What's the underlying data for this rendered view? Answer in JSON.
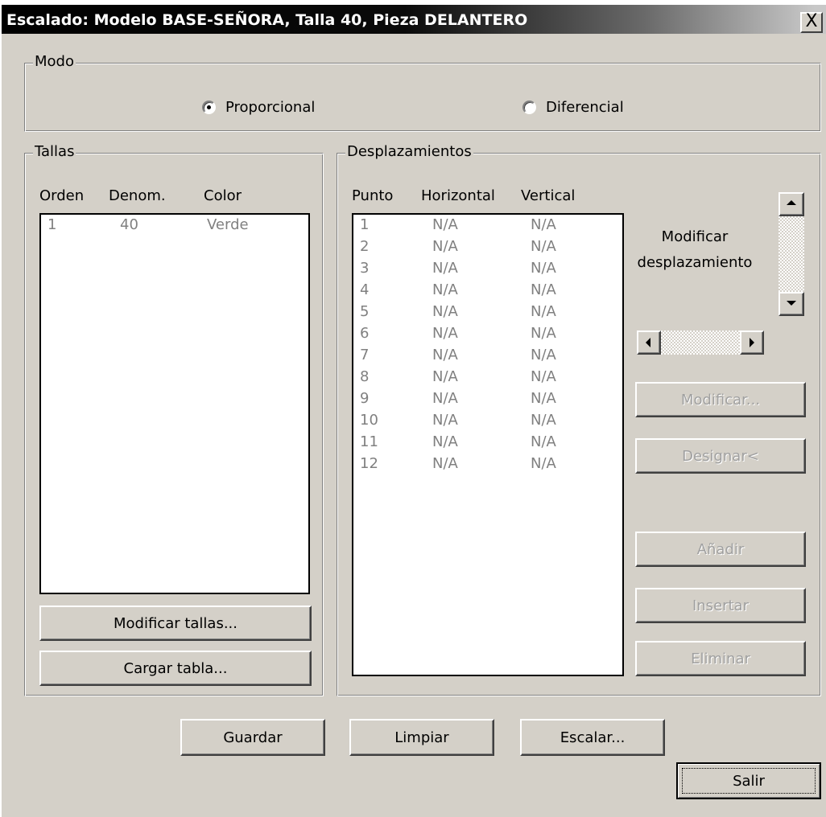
{
  "window": {
    "title": "Escalado: Modelo BASE-SEÑORA, Talla 40, Pieza DELANTERO",
    "close_label": "X"
  },
  "modo": {
    "legend": "Modo",
    "options": [
      {
        "label": "Proporcional",
        "selected": true
      },
      {
        "label": "Diferencial",
        "selected": false
      }
    ]
  },
  "tallas": {
    "legend": "Tallas",
    "headers": [
      "Orden",
      "Denom.",
      "Color"
    ],
    "rows": [
      {
        "orden": "1",
        "denom": "40",
        "color": "Verde"
      }
    ],
    "buttons": {
      "modificar": "Modificar tallas...",
      "cargar": "Cargar tabla..."
    }
  },
  "desplazamientos": {
    "legend": "Desplazamientos",
    "headers": [
      "Punto",
      "Horizontal",
      "Vertical"
    ],
    "rows": [
      {
        "punto": "1",
        "h": "N/A",
        "v": "N/A"
      },
      {
        "punto": "2",
        "h": "N/A",
        "v": "N/A"
      },
      {
        "punto": "3",
        "h": "N/A",
        "v": "N/A"
      },
      {
        "punto": "4",
        "h": "N/A",
        "v": "N/A"
      },
      {
        "punto": "5",
        "h": "N/A",
        "v": "N/A"
      },
      {
        "punto": "6",
        "h": "N/A",
        "v": "N/A"
      },
      {
        "punto": "7",
        "h": "N/A",
        "v": "N/A"
      },
      {
        "punto": "8",
        "h": "N/A",
        "v": "N/A"
      },
      {
        "punto": "9",
        "h": "N/A",
        "v": "N/A"
      },
      {
        "punto": "10",
        "h": "N/A",
        "v": "N/A"
      },
      {
        "punto": "11",
        "h": "N/A",
        "v": "N/A"
      },
      {
        "punto": "12",
        "h": "N/A",
        "v": "N/A"
      }
    ],
    "modificar_label_line1": "Modificar",
    "modificar_label_line2": "desplazamiento",
    "buttons": {
      "modificar": "Modificar...",
      "designar": "Designar<",
      "anadir": "Añadir",
      "insertar": "Insertar",
      "eliminar": "Eliminar"
    }
  },
  "footer": {
    "guardar": "Guardar",
    "limpiar": "Limpiar",
    "escalar": "Escalar...",
    "salir": "Salir"
  }
}
